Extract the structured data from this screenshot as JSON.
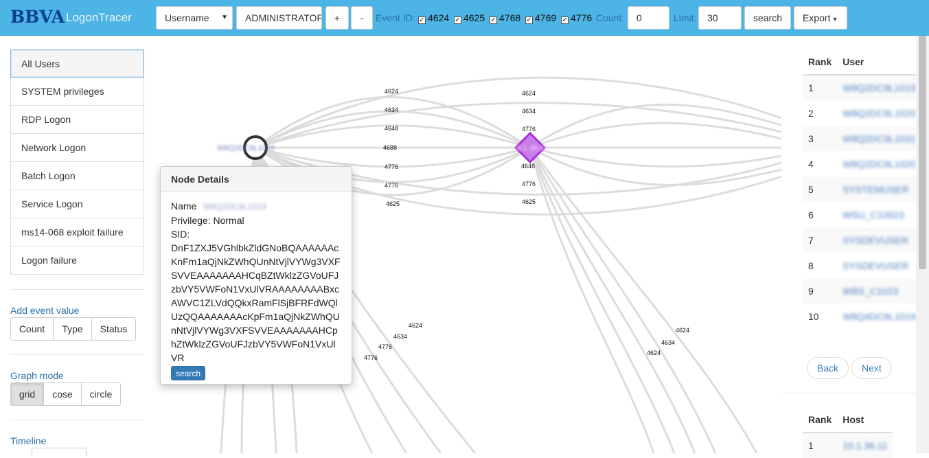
{
  "header": {
    "logo": "BBVA",
    "app_title": "LogonTracer",
    "search_type": "Username",
    "search_value": "ADMINISTRATOR",
    "plus_label": "+",
    "minus_label": "-",
    "event_id_label": "Event ID:",
    "event_ids": [
      {
        "id": "4624",
        "checked": true
      },
      {
        "id": "4625",
        "checked": true
      },
      {
        "id": "4768",
        "checked": true
      },
      {
        "id": "4769",
        "checked": true
      },
      {
        "id": "4776",
        "checked": true
      }
    ],
    "count_label": "Count:",
    "count_value": "0",
    "limit_label": "Limit:",
    "limit_value": "30",
    "search_button": "search",
    "export_button": "Export"
  },
  "sidebar": {
    "items": [
      {
        "label": "All Users",
        "active": true
      },
      {
        "label": "SYSTEM privileges"
      },
      {
        "label": "RDP Logon"
      },
      {
        "label": "Network Logon"
      },
      {
        "label": "Batch Logon"
      },
      {
        "label": "Service Logon"
      },
      {
        "label": "ms14-068 exploit failure"
      },
      {
        "label": "Logon failure"
      }
    ],
    "add_event_value": {
      "heading": "Add event value",
      "buttons": [
        "Count",
        "Type",
        "Status"
      ]
    },
    "graph_mode": {
      "heading": "Graph mode",
      "buttons": [
        "grid",
        "cose",
        "circle"
      ],
      "active": "grid"
    },
    "timeline": {
      "heading": "Timeline"
    }
  },
  "graph": {
    "user_node_label": "W8Q2DC9L1019",
    "host_node_label": "10.1.36.11",
    "top_edge_labels_left": [
      "4624",
      "4634",
      "4648",
      "4688",
      "4776",
      "4776",
      "4625"
    ],
    "top_edge_labels_right": [
      "4624",
      "4634",
      "4776",
      "4648",
      "4776",
      "4625"
    ],
    "lower_edge_labels_left": [
      "4624",
      "4634",
      "4776",
      "4776"
    ],
    "lower_edge_labels_right": [
      "4624",
      "4634",
      "4624"
    ]
  },
  "node_details": {
    "title": "Node Details",
    "name_label": "Name",
    "name_value": "W8Q2DC9L1019",
    "privilege_line": "Privilege: Normal",
    "sid_label": "SID:",
    "sid_value": "DnF1ZXJ5VGhlbkZldGNoBQAAAAAAcKnFm1aQjNkZWhQUnNtVjlVYWg3VXFSVVEAAAAAAAHCqBZtWklzZGVoUFJzbVY5VWFoN1VxUlVRAAAAAAAABxcAWVC1ZLVdQQkxRamFlSjBFRFdWQlUzQQAAAAAAAcKpFm1aQjNkZWhQUnNtVjlVYWg3VXFSVVEAAAAAAAHCphZtWklzZGVoUFJzbVY5VWFoN1VxUlVR",
    "search_button": "search"
  },
  "user_rank": {
    "headers": [
      "Rank",
      "User"
    ],
    "rows": [
      {
        "rank": "1",
        "user": "W8Q2DC9L1019"
      },
      {
        "rank": "2",
        "user": "W8Q2DC9L1020"
      },
      {
        "rank": "3",
        "user": "W8Q2DC9L1031"
      },
      {
        "rank": "4",
        "user": "W8Q2DC9L1020"
      },
      {
        "rank": "5",
        "user": "SYSTEMUSER"
      },
      {
        "rank": "6",
        "user": "WSU_C10023"
      },
      {
        "rank": "7",
        "user": "SYSDEVUSER"
      },
      {
        "rank": "8",
        "user": "SYSDEVUSER"
      },
      {
        "rank": "9",
        "user": "WBS_C1023"
      },
      {
        "rank": "10",
        "user": "W8Q4DC9L1019"
      }
    ],
    "back_label": "Back",
    "next_label": "Next"
  },
  "host_rank": {
    "headers": [
      "Rank",
      "Host"
    ],
    "rows": [
      {
        "rank": "1",
        "host": "10.1.36.11"
      }
    ]
  },
  "colors": {
    "topbar": "#4db4e6",
    "logo": "#0b3d91",
    "link": "#2a6fa8",
    "host_node": "#a832d6",
    "edge": "#dcdcdc"
  }
}
